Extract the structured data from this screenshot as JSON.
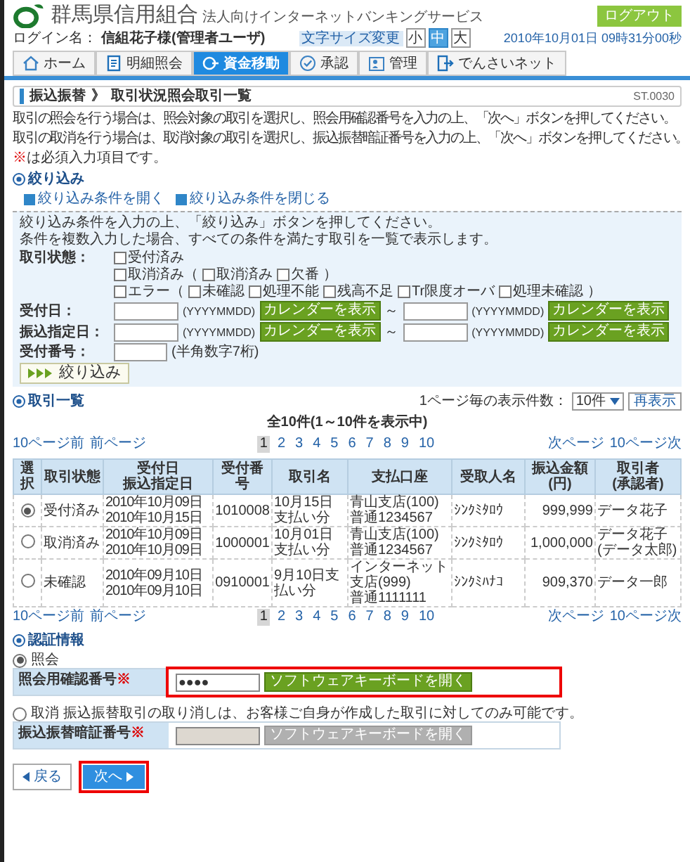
{
  "header": {
    "logo_name": "群馬県信用組合",
    "service_name": "法人向けインターネットバンキングサービス",
    "login_label": "ログイン名：",
    "login_user": "信組花子様(管理者ユーザ)",
    "logout": "ログアウト",
    "font_size_label": "文字サイズ変更",
    "font_sizes": [
      {
        "label": "小",
        "selected": false
      },
      {
        "label": "中",
        "selected": true
      },
      {
        "label": "大",
        "selected": false
      }
    ],
    "datetime": "2010年10月01日 09時31分00秒"
  },
  "nav_tabs": [
    {
      "label": "ホーム",
      "selected": false
    },
    {
      "label": "明細照会",
      "selected": false
    },
    {
      "label": "資金移動",
      "selected": true
    },
    {
      "label": "承認",
      "selected": false
    },
    {
      "label": "管理",
      "selected": false
    },
    {
      "label": "でんさいネット",
      "selected": false
    }
  ],
  "page": {
    "breadcrumb": "振込振替",
    "separator": "》",
    "title": "取引状況照会取引一覧",
    "screen_id": "ST.0030"
  },
  "instructions": [
    "取引の照会を行う場合は、照会対象の取引を選択し、照会用確認番号を入力の上、「次へ」ボタンを押してください。",
    "取引の取消を行う場合は、取消対象の取引を選択し、振込振替暗証番号を入力の上、「次へ」ボタンを押してください。"
  ],
  "required_note": {
    "mark": "※",
    "text": "は必須入力項目です。"
  },
  "filter": {
    "heading": "絞り込み",
    "open_link": "絞り込み条件を開く",
    "close_link": "絞り込み条件を閉じる",
    "hints": [
      "絞り込み条件を入力の上、「絞り込み」ボタンを押してください。",
      "条件を複数入力した場合、すべての条件を満たす取引を一覧で表示します。"
    ],
    "status_label": "取引状態：",
    "status_rows": [
      [
        {
          "kind": "checkbox",
          "label": "受付済み",
          "checked": false
        }
      ],
      [
        {
          "kind": "checkbox",
          "label": "取消済み（",
          "checked": false
        },
        {
          "kind": "checkbox",
          "label": "取消済み",
          "checked": false
        },
        {
          "kind": "checkbox",
          "label": "欠番",
          "checked": false
        },
        {
          "kind": "text",
          "label": "）"
        }
      ],
      [
        {
          "kind": "checkbox",
          "label": "エラー（",
          "checked": false
        },
        {
          "kind": "checkbox",
          "label": "未確認",
          "checked": false
        },
        {
          "kind": "checkbox",
          "label": "処理不能",
          "checked": false
        },
        {
          "kind": "checkbox",
          "label": "残高不足",
          "checked": false
        },
        {
          "kind": "checkbox",
          "label": "Tr限度オーバ",
          "checked": false
        },
        {
          "kind": "checkbox",
          "label": "処理未確認",
          "checked": false
        },
        {
          "kind": "text",
          "label": "）"
        }
      ]
    ],
    "fields": [
      {
        "kind": "date_range",
        "label": "受付日：",
        "from_format": "(YYYYMMDD)",
        "from_button": "カレンダーを表示",
        "range_sep": "～",
        "to_format": "(YYYYMMDD)",
        "to_button": "カレンダーを表示"
      },
      {
        "kind": "date_range",
        "label": "振込指定日：",
        "from_format": "(YYYYMMDD)",
        "from_button": "カレンダーを表示",
        "range_sep": "～",
        "to_format": "(YYYYMMDD)",
        "to_button": "カレンダーを表示"
      },
      {
        "kind": "text",
        "label": "受付番号：",
        "hint": "(半角数字7桁)"
      }
    ],
    "submit": "絞り込み"
  },
  "list": {
    "heading": "取引一覧",
    "per_page_label": "1ページ毎の表示件数：",
    "per_page_value": "10件",
    "redisplay": "再表示",
    "count": "全10件(1～10件を表示中)",
    "pagers": [
      {
        "prev10": "10ページ前",
        "prev": "前ページ",
        "pages": [
          {
            "label": "1",
            "selected": true
          },
          {
            "label": "2",
            "selected": false
          },
          {
            "label": "3",
            "selected": false
          },
          {
            "label": "4",
            "selected": false
          },
          {
            "label": "5",
            "selected": false
          },
          {
            "label": "6",
            "selected": false
          },
          {
            "label": "7",
            "selected": false
          },
          {
            "label": "8",
            "selected": false
          },
          {
            "label": "9",
            "selected": false
          },
          {
            "label": "10",
            "selected": false
          }
        ],
        "next": "次ページ",
        "next10": "10ページ次"
      },
      {
        "prev10": "10ページ前",
        "prev": "前ページ",
        "pages": [
          {
            "label": "1",
            "selected": true
          },
          {
            "label": "2",
            "selected": false
          },
          {
            "label": "3",
            "selected": false
          },
          {
            "label": "4",
            "selected": false
          },
          {
            "label": "5",
            "selected": false
          },
          {
            "label": "6",
            "selected": false
          },
          {
            "label": "7",
            "selected": false
          },
          {
            "label": "8",
            "selected": false
          },
          {
            "label": "9",
            "selected": false
          },
          {
            "label": "10",
            "selected": false
          }
        ],
        "next": "次ページ",
        "next10": "10ページ次"
      }
    ],
    "columns": [
      [
        "選択"
      ],
      [
        "取引状態"
      ],
      [
        "受付日",
        "振込指定日"
      ],
      [
        "受付番号"
      ],
      [
        "取引名"
      ],
      [
        "支払口座"
      ],
      [
        "受取人名"
      ],
      [
        "振込金額(円)"
      ],
      [
        "取引者",
        "(承認者)"
      ]
    ],
    "rows": [
      {
        "selected": true,
        "status": "受付済み",
        "dates": [
          "2010年10月09日",
          "2010年10月15日"
        ],
        "number": "1010008",
        "name": "10月15日支払い分",
        "account": [
          "青山支店(100)",
          "普通1234567"
        ],
        "payee": "ｼﾝｸﾐﾀﾛｳ",
        "amount": "999,999",
        "users": [
          "データ花子"
        ]
      },
      {
        "selected": false,
        "status": "取消済み",
        "dates": [
          "2010年10月09日",
          "2010年10月09日"
        ],
        "number": "1000001",
        "name": "10月01日支払い分",
        "account": [
          "青山支店(100)",
          "普通1234567"
        ],
        "payee": "ｼﾝｸﾐﾀﾛｳ",
        "amount": "1,000,000",
        "users": [
          "データ花子",
          "(データ太郎)"
        ]
      },
      {
        "selected": false,
        "status": "未確認",
        "dates": [
          "2010年09月10日",
          "2010年09月10日"
        ],
        "number": "0910001",
        "name": "9月10日支払い分",
        "account": [
          "インターネット支店(999)",
          "普通1111111"
        ],
        "payee": "ｼﾝｸﾐﾊﾅｺ",
        "amount": "909,370",
        "users": [
          "データ一郎"
        ]
      }
    ]
  },
  "auth": {
    "heading": "認証情報",
    "options": [
      {
        "option_text": "照会",
        "selected": true,
        "field": {
          "label": "照会用確認番号",
          "required_mark": "※",
          "value": "●●●●",
          "keyboard_button": "ソフトウェアキーボードを開く",
          "disabled": false
        }
      },
      {
        "option_text": "取消 振込振替取引の取り消しは、お客様ご自身が作成した取引に対してのみ可能です。",
        "selected": false,
        "field": {
          "label": "振込振替暗証番号",
          "required_mark": "※",
          "keyboard_button": "ソフトウェアキーボードを開く",
          "disabled": true
        }
      }
    ]
  },
  "buttons": {
    "back": "戻る",
    "next": "次へ"
  }
}
